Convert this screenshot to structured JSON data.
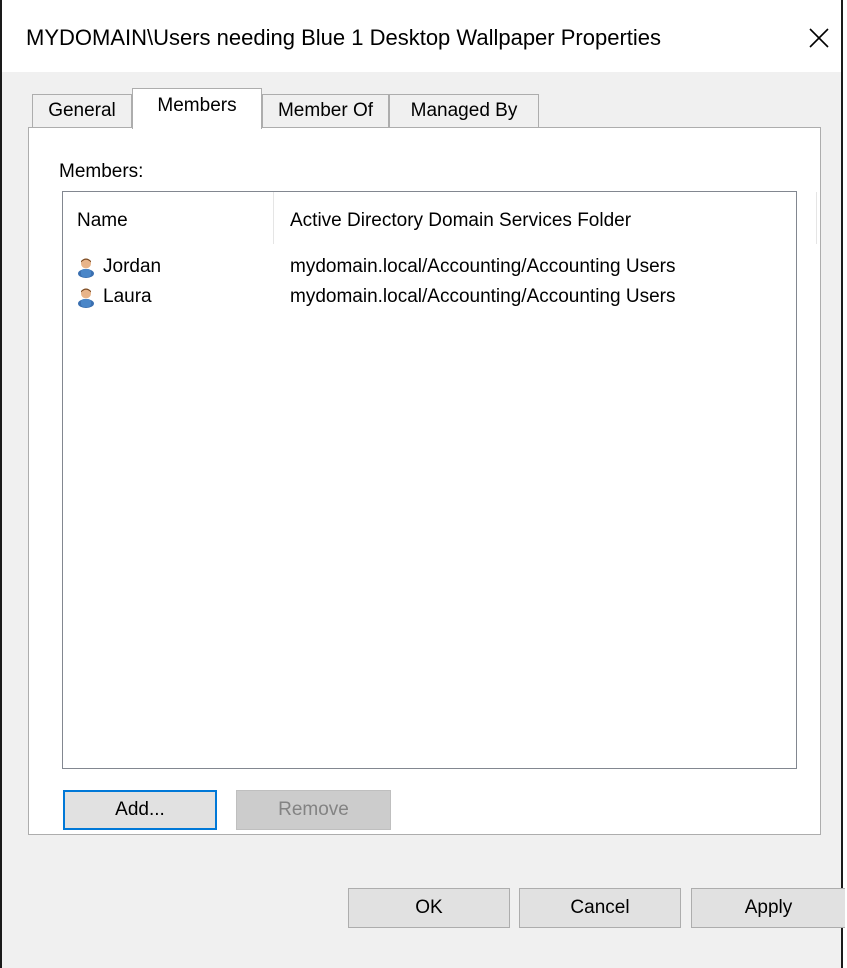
{
  "window": {
    "title": "MYDOMAIN\\Users needing Blue 1 Desktop Wallpaper Properties",
    "close_glyph": "✕"
  },
  "tabs": [
    {
      "label": "General",
      "active": false
    },
    {
      "label": "Members",
      "active": true
    },
    {
      "label": "Member Of",
      "active": false
    },
    {
      "label": "Managed By",
      "active": false
    }
  ],
  "members": {
    "label": "Members:",
    "columns": {
      "name": "Name",
      "folder": "Active Directory Domain Services Folder"
    },
    "rows": [
      {
        "icon": "user-icon",
        "name": "Jordan",
        "folder": "mydomain.local/Accounting/Accounting Users"
      },
      {
        "icon": "user-icon",
        "name": "Laura",
        "folder": "mydomain.local/Accounting/Accounting Users"
      }
    ],
    "add_label": "Add...",
    "remove_label": "Remove"
  },
  "footer": {
    "ok_label": "OK",
    "cancel_label": "Cancel",
    "apply_label": "Apply"
  },
  "colors": {
    "focus_border": "#0078d7",
    "disabled_text": "#838383"
  }
}
